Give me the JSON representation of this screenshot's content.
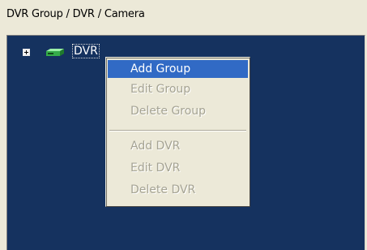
{
  "panel": {
    "label": "DVR Group / DVR / Camera"
  },
  "tree": {
    "root": {
      "label": "DVR",
      "expander": "+",
      "icon": "dvr-device-icon",
      "icon_color": "#5cc86a"
    },
    "background": "#15325f"
  },
  "context_menu": {
    "items": [
      {
        "label": "Add Group",
        "enabled": true,
        "highlighted": true
      },
      {
        "label": "Edit Group",
        "enabled": false,
        "highlighted": false
      },
      {
        "label": "Delete Group",
        "enabled": false,
        "highlighted": false
      },
      {
        "label": "Add DVR",
        "enabled": false,
        "highlighted": false
      },
      {
        "label": "Edit DVR",
        "enabled": false,
        "highlighted": false
      },
      {
        "label": "Delete DVR",
        "enabled": false,
        "highlighted": false
      }
    ],
    "highlight_color": "#316ac5",
    "disabled_color": "#a5a393"
  }
}
